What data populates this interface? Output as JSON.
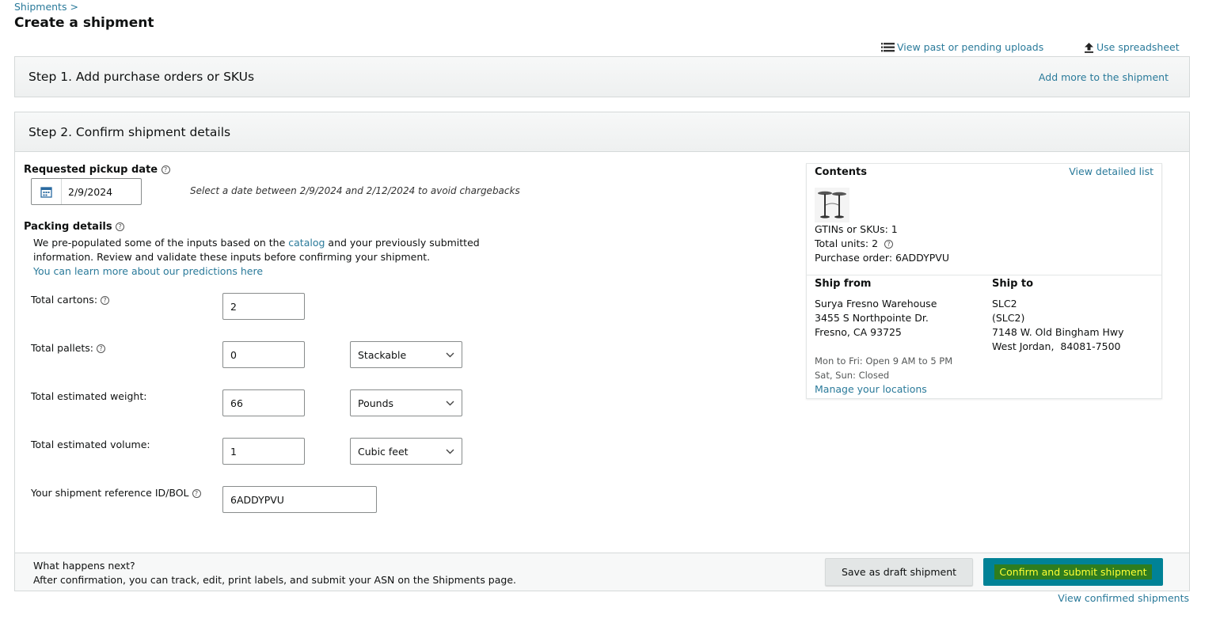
{
  "breadcrumb": "Shipments >",
  "page_title": "Create a shipment",
  "top_links": {
    "past_uploads": "View past or pending uploads",
    "use_spreadsheet": "Use spreadsheet"
  },
  "step1": {
    "title": "Step 1. Add purchase orders or SKUs",
    "add_more": "Add more to the shipment"
  },
  "step2": {
    "title": "Step 2. Confirm shipment details"
  },
  "pickup": {
    "label": "Requested pickup date",
    "date": "2/9/2024",
    "hint": "Select a date between 2/9/2024 and 2/12/2024 to avoid chargebacks"
  },
  "packing": {
    "label": "Packing details",
    "desc_part1": "We pre-populated some of the inputs based on the",
    "desc_link": "catalog",
    "desc_part2": "and your previously submitted",
    "desc_line2": "information. Review and validate these inputs before confirming your shipment.",
    "learn_more": "You can learn more about our predictions here"
  },
  "fields": {
    "cartons": {
      "label": "Total cartons:",
      "value": "2"
    },
    "pallets": {
      "label": "Total pallets:",
      "value": "0",
      "option": "Stackable"
    },
    "weight": {
      "label": "Total estimated weight:",
      "value": "66",
      "option": "Pounds"
    },
    "volume": {
      "label": "Total estimated volume:",
      "value": "1",
      "option": "Cubic feet"
    },
    "reference": {
      "label": "Your shipment reference ID/BOL",
      "value": "6ADDYPVU"
    }
  },
  "contents": {
    "title": "Contents",
    "view_list": "View detailed list",
    "gtins": "GTINs or SKUs: 1",
    "total_units": "Total units: 2",
    "purchase_order": "Purchase order: 6ADDYPVU"
  },
  "ship_from": {
    "title": "Ship from",
    "name": "Surya Fresno Warehouse",
    "address1": "3455 S Northpointe Dr.",
    "address2": "Fresno, CA 93725",
    "hours1": "Mon to Fri: Open 9 AM to 5 PM",
    "hours2": "Sat, Sun: Closed",
    "manage": "Manage your locations"
  },
  "ship_to": {
    "title": "Ship to",
    "line1": "SLC2",
    "line2": "(SLC2)",
    "line3": "7148 W. Old Bingham Hwy",
    "line4": "West Jordan,  84081-7500"
  },
  "footer": {
    "next_title": "What happens next?",
    "next_desc": "After confirmation, you can track, edit, print labels, and submit your ASN on the Shipments page.",
    "draft_button": "Save as draft shipment",
    "confirm_button": "Confirm and submit shipment",
    "view_confirmed": "View confirmed shipments"
  },
  "icons": {
    "list": "list-icon",
    "upload": "upload-icon",
    "calendar": "calendar-icon",
    "help": "help-circle-icon",
    "chevron": "chevron-down-icon",
    "product": "product-thumbnail"
  },
  "colors": {
    "link": "#2a7a9a",
    "confirm_bg": "#008296",
    "highlight": "#2e7d1f",
    "highlight_text": "#ffff33"
  }
}
